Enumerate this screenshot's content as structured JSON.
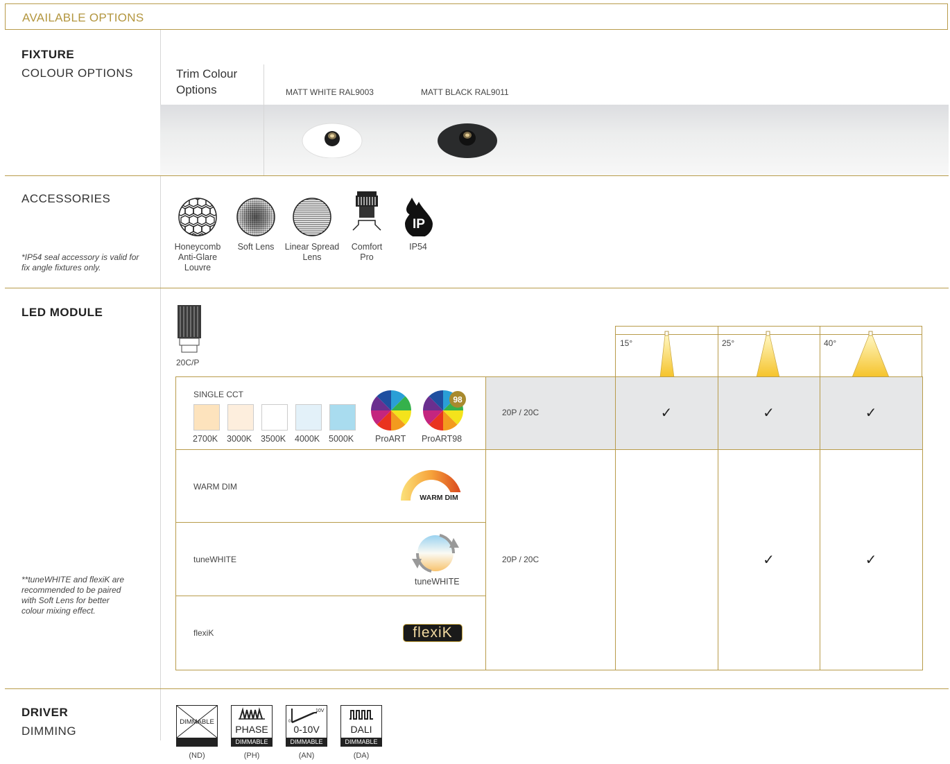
{
  "header": {
    "title": "AVAILABLE OPTIONS"
  },
  "fixture": {
    "title": "FIXTURE",
    "subtitle": "COLOUR OPTIONS",
    "trim_label": "Trim Colour Options",
    "colours": [
      {
        "label": "MATT WHITE RAL9003",
        "hex": "#ffffff"
      },
      {
        "label": "MATT BLACK RAL9011",
        "hex": "#2a2b2c"
      }
    ]
  },
  "accessories": {
    "title": "ACCESSORIES",
    "note": "*IP54 seal accessory is valid for fix angle fixtures only.",
    "items": [
      {
        "label": "Honeycomb Anti-Glare Louvre",
        "icon": "honeycomb-icon"
      },
      {
        "label": "Soft Lens",
        "icon": "soft-lens-icon"
      },
      {
        "label": "Linear Spread Lens",
        "icon": "linear-lens-icon"
      },
      {
        "label": "Comfort Pro",
        "icon": "comfort-pro-icon"
      },
      {
        "label": "IP54",
        "icon": "ip54-icon",
        "badge": "IP"
      }
    ]
  },
  "led_module": {
    "title": "LED MODULE",
    "module_label": "20C/P",
    "note": "**tuneWHITE and flexiK are recommended to be paired with Soft Lens for better colour mixing effect.",
    "beam_angles": [
      "15°",
      "25°",
      "40°"
    ],
    "single_cct": {
      "label": "SINGLE CCT",
      "swatches": [
        {
          "label": "2700K",
          "hex": "#fde3bd"
        },
        {
          "label": "3000K",
          "hex": "#fdeedd"
        },
        {
          "label": "3500K",
          "hex": "#ffffff"
        },
        {
          "label": "4000K",
          "hex": "#e3f1f9"
        },
        {
          "label": "5000K",
          "hex": "#a9dcef"
        }
      ],
      "proart_label": "ProART",
      "proart98_label": "ProART98",
      "proart98_badge": "98",
      "module_code": "20P / 20C",
      "checks": [
        "✓",
        "✓",
        "✓"
      ]
    },
    "warm_dim": {
      "label": "WARM DIM",
      "logo_text": "WARM DIM"
    },
    "tune_white": {
      "label": "tuneWHITE",
      "logo_text": "tuneWHITE",
      "checks": [
        "",
        "✓",
        "✓"
      ]
    },
    "flexik": {
      "label": "flexiK",
      "logo_text": "flexiK"
    },
    "merged_code": "20P / 20C"
  },
  "driver": {
    "title": "DRIVER",
    "subtitle": "DIMMING",
    "items": [
      {
        "code": "(ND)",
        "main": "DIMMABLE",
        "strip": ""
      },
      {
        "code": "(PH)",
        "main": "PHASE",
        "strip": "DIMMABLE"
      },
      {
        "code": "(AN)",
        "main": "0-10V",
        "strip": "DIMMABLE",
        "top": "10V",
        "zero": "0"
      },
      {
        "code": "(DA)",
        "main": "DALI",
        "strip": "DIMMABLE"
      }
    ]
  },
  "colors": {
    "accent": "#b89b4a",
    "header_text": "#b3963f",
    "grey_row": "#e6e7e8"
  }
}
